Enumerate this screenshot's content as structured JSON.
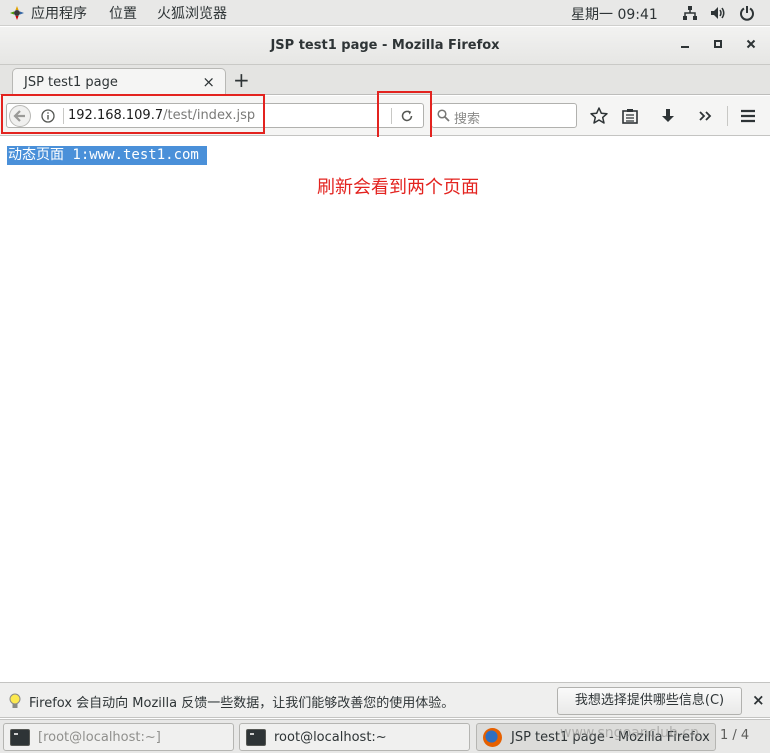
{
  "topbar": {
    "apps_menu": "应用程序",
    "places_menu": "位置",
    "firefox_menu": "火狐浏览器",
    "clock": "星期一 09:41"
  },
  "window": {
    "title": "JSP test1 page - Mozilla Firefox"
  },
  "tabs": [
    {
      "label": "JSP test1 page",
      "close": "×"
    }
  ],
  "new_tab": "+",
  "urlbar": {
    "host": "192.168.109.7",
    "path": "/test/index.jsp"
  },
  "search": {
    "placeholder": "搜索"
  },
  "page": {
    "selected_text": "动态页面 1:www.test1.com",
    "annotation": "刷新会看到两个页面"
  },
  "notification": {
    "message": "Firefox 会自动向 Mozilla 反馈一些数据，让我们能够改善您的使用体验。",
    "button": "我想选择提供哪些信息(C)",
    "close": "×"
  },
  "taskbar": {
    "items": [
      {
        "label": "[root@localhost:~]"
      },
      {
        "label": "root@localhost:~"
      },
      {
        "label": "JSP test1 page - Mozilla Firefox"
      }
    ],
    "watermark": "www.sngoanclub.cn",
    "pager": "1 / 4"
  },
  "colors": {
    "annotation_red": "#e3231f",
    "selection_blue": "#4a90d9"
  }
}
